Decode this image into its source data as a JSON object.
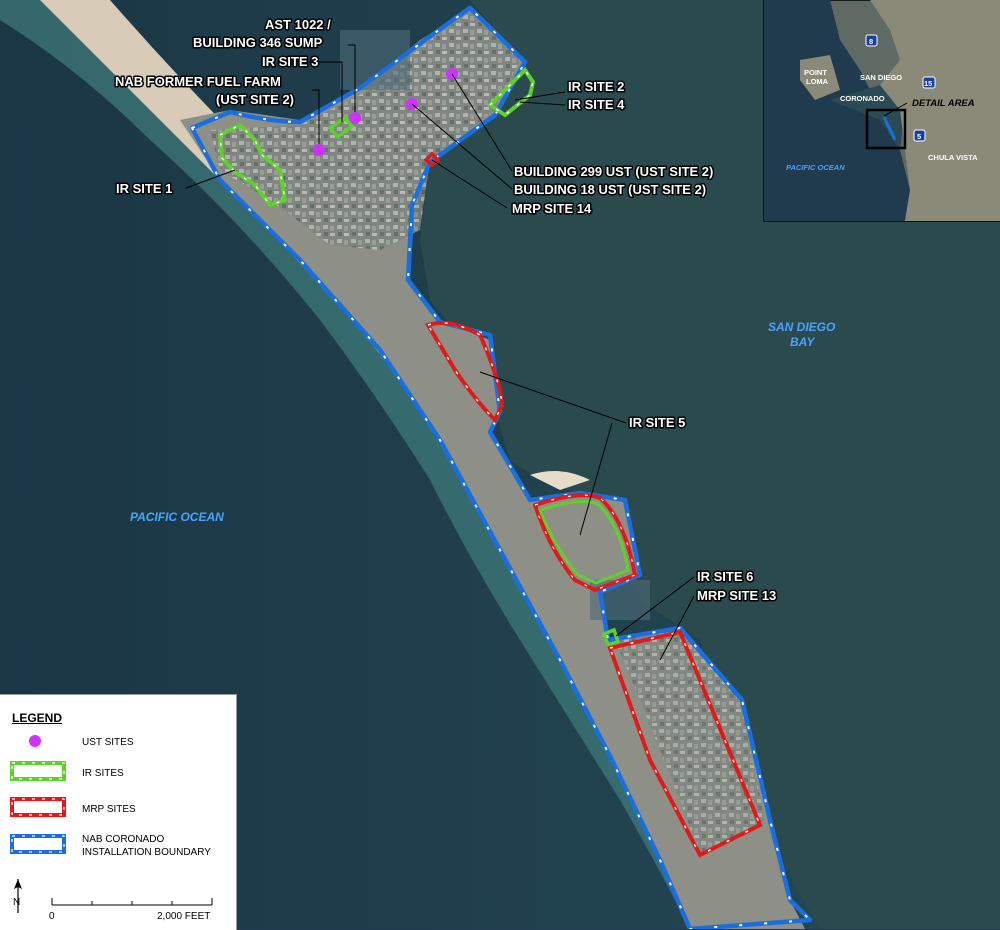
{
  "map": {
    "labels": {
      "ast_1022": "AST 1022 /",
      "building_346_sump": "BUILDING 346 SUMP",
      "ir_site_3": "IR SITE 3",
      "nab_former_fuel_farm": "NAB FORMER FUEL FARM",
      "ust_site_2_paren": "(UST SITE 2)",
      "ir_site_1": "IR SITE 1",
      "ir_site_2": "IR SITE 2",
      "ir_site_4": "IR SITE 4",
      "building_299_ust": "BUILDING 299 UST (UST SITE 2)",
      "building_18_ust": "BUILDING 18 UST (UST SITE 2)",
      "mrp_site_14": "MRP SITE 14",
      "ir_site_5": "IR SITE 5",
      "ir_site_6": "IR SITE 6",
      "mrp_site_13": "MRP SITE 13"
    },
    "water_labels": {
      "pacific_ocean": "PACIFIC OCEAN",
      "san_diego": "SAN DIEGO",
      "bay": "BAY"
    }
  },
  "inset": {
    "point": "POINT",
    "loma": "LOMA",
    "san_diego": "SAN DIEGO",
    "coronado": "CORONADO",
    "chula_vista": "CHULA VISTA",
    "pacific_ocean": "PACIFIC OCEAN",
    "detail_area": "DETAIL AREA",
    "highway_8": "8",
    "highway_15": "15",
    "highway_5": "5"
  },
  "legend": {
    "title": "LEGEND",
    "items": [
      {
        "label": "UST SITES"
      },
      {
        "label": "IR SITES"
      },
      {
        "label": "MRP SITES"
      },
      {
        "label": "NAB CORONADO",
        "label2": "INSTALLATION BOUNDARY"
      }
    ],
    "north_symbol": "N",
    "scale_start": "0",
    "scale_end": "2,000 FEET"
  },
  "colors": {
    "ust": "#cc33ff",
    "ir": "#5fd12e",
    "mrp": "#e01a1a",
    "boundary": "#1a6fe0",
    "ocean": "#1f3b4d",
    "bay": "#2b4a4f",
    "beach": "#d9cfbf",
    "land": "#8a8f84"
  }
}
